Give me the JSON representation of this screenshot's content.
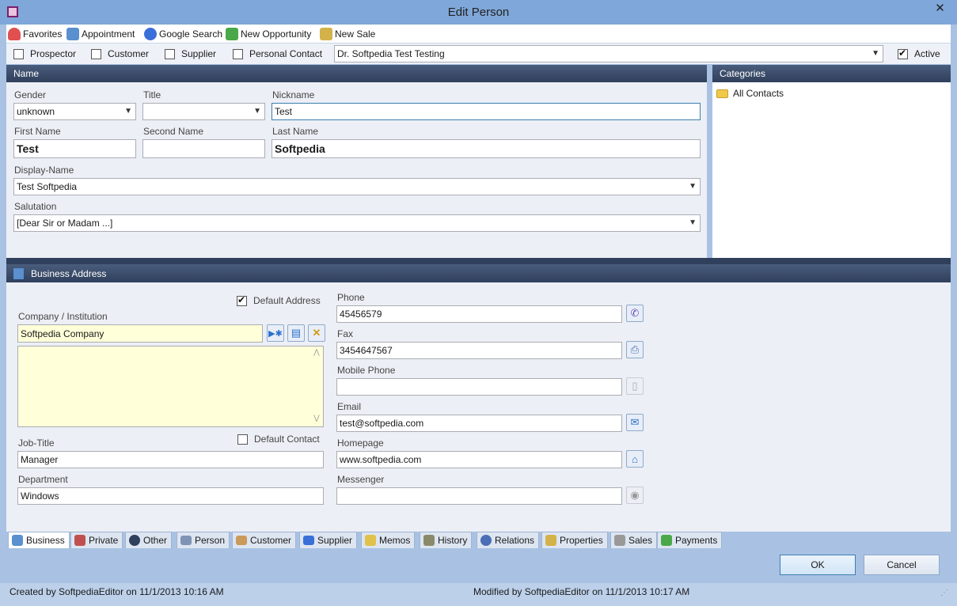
{
  "window": {
    "title": "Edit Person",
    "close_glyph": "✕"
  },
  "toolbar": {
    "items": [
      {
        "label": "Favorites",
        "icon": "heart-icon",
        "color": "#e05050"
      },
      {
        "label": "Appointment",
        "icon": "calendar-icon",
        "color": "#5a8fd0"
      },
      {
        "label": "Google Search",
        "icon": "google-icon",
        "color": "#3a6fd8"
      },
      {
        "label": "New Opportunity",
        "icon": "arrows-icon",
        "color": "#4aa84a"
      },
      {
        "label": "New Sale",
        "icon": "cart-icon",
        "color": "#d4b24a"
      }
    ]
  },
  "types": {
    "prospector": {
      "label": "Prospector",
      "checked": false
    },
    "customer": {
      "label": "Customer",
      "checked": false
    },
    "supplier": {
      "label": "Supplier",
      "checked": false
    },
    "personal_contact": {
      "label": "Personal Contact",
      "checked": false
    },
    "contact_combo": "Dr. Softpedia Test Testing",
    "active": {
      "label": "Active",
      "checked": true
    }
  },
  "name_section": {
    "header": "Name",
    "gender_label": "Gender",
    "gender_value": "unknown",
    "title_label": "Title",
    "title_value": "",
    "nickname_label": "Nickname",
    "nickname_value": "Test",
    "first_name_label": "First Name",
    "first_name_value": "Test",
    "second_name_label": "Second Name",
    "second_name_value": "",
    "last_name_label": "Last Name",
    "last_name_value": "Softpedia",
    "display_name_label": "Display-Name",
    "display_name_value": "Test Softpedia",
    "salutation_label": "Salutation",
    "salutation_value": "[Dear Sir or Madam ...]"
  },
  "categories": {
    "header": "Categories",
    "items": [
      "All Contacts"
    ]
  },
  "business": {
    "header": "Business Address",
    "default_address_label": "Default Address",
    "default_address_checked": true,
    "company_label": "Company / Institution",
    "company_value": "Softpedia Company",
    "address_text": "",
    "default_contact_label": "Default Contact",
    "default_contact_checked": false,
    "job_title_label": "Job-Title",
    "job_title_value": "Manager",
    "department_label": "Department",
    "department_value": "Windows",
    "phone_label": "Phone",
    "phone_value": "45456579",
    "fax_label": "Fax",
    "fax_value": "3454647567",
    "mobile_label": "Mobile Phone",
    "mobile_value": "",
    "email_label": "Email",
    "email_value": "test@softpedia.com",
    "homepage_label": "Homepage",
    "homepage_value": "www.softpedia.com",
    "messenger_label": "Messenger",
    "messenger_value": ""
  },
  "tabs": [
    {
      "label": "Business",
      "icon": "building-icon",
      "active": true
    },
    {
      "label": "Private",
      "icon": "house-icon",
      "active": false
    },
    {
      "label": "Other",
      "icon": "globe-icon",
      "active": false
    },
    {
      "label": "Person",
      "icon": "id-card-icon",
      "active": false
    },
    {
      "label": "Customer",
      "icon": "handshake-icon",
      "active": false
    },
    {
      "label": "Supplier",
      "icon": "truck-icon",
      "active": false
    },
    {
      "label": "Memos",
      "icon": "note-icon",
      "active": false
    },
    {
      "label": "History",
      "icon": "history-icon",
      "active": false
    },
    {
      "label": "Relations",
      "icon": "relations-icon",
      "active": false
    },
    {
      "label": "Properties",
      "icon": "properties-icon",
      "active": false
    },
    {
      "label": "Sales",
      "icon": "cart-icon",
      "active": false
    },
    {
      "label": "Payments",
      "icon": "payments-icon",
      "active": false
    }
  ],
  "buttons": {
    "ok": "OK",
    "cancel": "Cancel"
  },
  "status": {
    "created": "Created by SoftpediaEditor on 11/1/2013 10:16 AM",
    "modified": "Modified by SoftpediaEditor on 11/1/2013 10:17 AM"
  }
}
